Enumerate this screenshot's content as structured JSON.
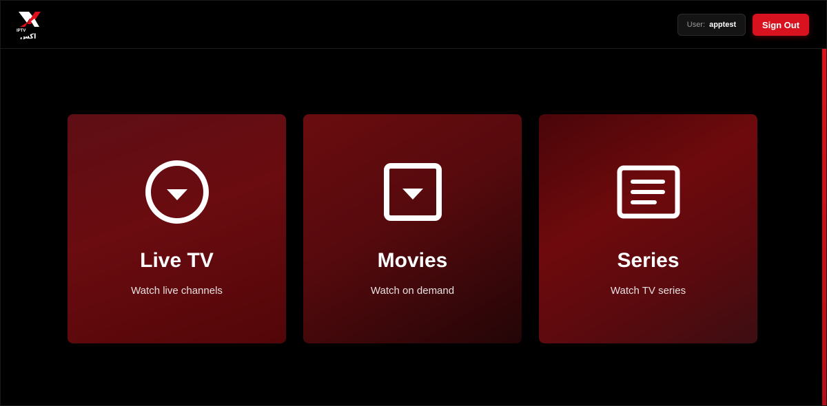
{
  "header": {
    "logo": {
      "brand_text": "IPTV",
      "arabic_text": "اكس"
    },
    "user": {
      "label": "User:",
      "name": "apptest"
    },
    "signout_label": "Sign Out"
  },
  "cards": [
    {
      "title": "Live TV",
      "subtitle": "Watch live channels",
      "icon": "circle-down-arrow-icon"
    },
    {
      "title": "Movies",
      "subtitle": "Watch on demand",
      "icon": "square-down-arrow-icon"
    },
    {
      "title": "Series",
      "subtitle": "Watch TV series",
      "icon": "text-lines-icon"
    }
  ],
  "colors": {
    "accent": "#d8121e",
    "background": "#000000",
    "card_red": "#6a0c10"
  }
}
